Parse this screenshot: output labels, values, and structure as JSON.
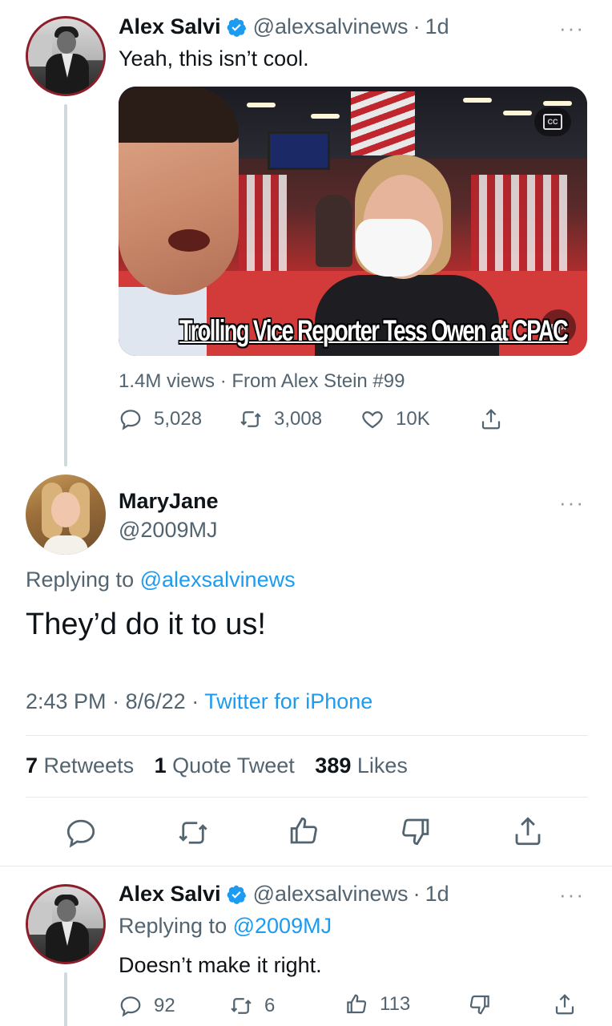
{
  "tweet1": {
    "name": "Alex Salvi",
    "handle": "@alexsalvinews",
    "separator": "·",
    "time": "1d",
    "more": "···",
    "text": "Yeah, this isn’t cool.",
    "media_caption": "Trolling Vice Reporter Tess Owen at CPAC",
    "media_cc": "CC",
    "views_text": "1.4M views · From Alex Stein #99",
    "actions": {
      "replies": "5,028",
      "retweets": "3,008",
      "likes": "10K"
    }
  },
  "tweet2": {
    "name": "MaryJane",
    "handle": "@2009MJ",
    "more": "···",
    "replying_prefix": "Replying to",
    "replying_to": "@alexsalvinews",
    "text": "They’d do it to us!",
    "time": "2:43 PM",
    "date": "8/6/22",
    "sep": "·",
    "source": "Twitter for iPhone",
    "stats": {
      "retweets_count": "7",
      "retweets_label": "Retweets",
      "quotes_count": "1",
      "quotes_label": "Quote Tweet",
      "likes_count": "389",
      "likes_label": "Likes"
    }
  },
  "tweet3": {
    "name": "Alex Salvi",
    "handle": "@alexsalvinews",
    "separator": "·",
    "time": "1d",
    "more": "···",
    "replying_prefix": "Replying to",
    "replying_to": "@2009MJ",
    "text": "Doesn’t make it right.",
    "actions": {
      "replies": "92",
      "retweets": "6",
      "likes": "113"
    }
  },
  "colors": {
    "accent": "#1d9bf0",
    "muted": "#536471",
    "text": "#0f1419",
    "avatar_ring": "#8b1e2b"
  }
}
